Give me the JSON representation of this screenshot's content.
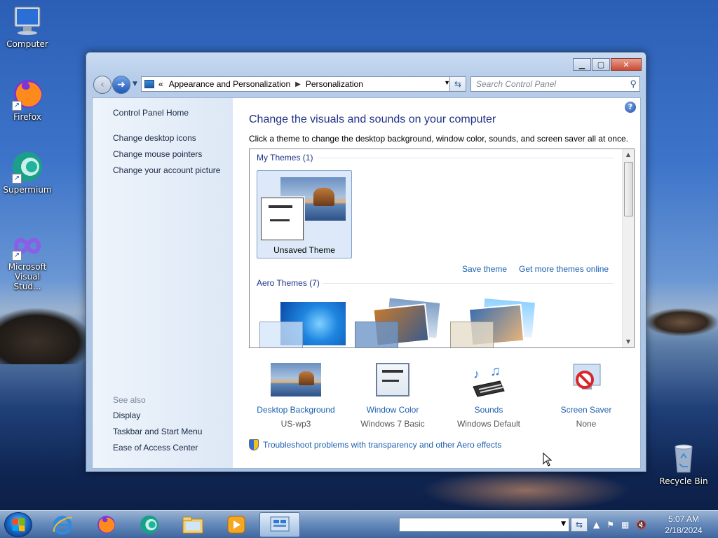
{
  "desktop": {
    "icons": [
      {
        "label": "Computer",
        "icon": "computer-icon"
      },
      {
        "label": "Firefox",
        "icon": "firefox-icon"
      },
      {
        "label": "Supermium",
        "icon": "supermium-icon"
      },
      {
        "label": "Microsoft Visual Stud...",
        "icon": "visual-studio-icon"
      },
      {
        "label": "Recycle Bin",
        "icon": "recycle-bin-icon"
      }
    ]
  },
  "window": {
    "address": {
      "prefix": "«",
      "crumbs": [
        "Appearance and Personalization",
        "Personalization"
      ]
    },
    "search_placeholder": "Search Control Panel",
    "left_pane": {
      "home": "Control Panel Home",
      "tasks": [
        "Change desktop icons",
        "Change mouse pointers",
        "Change your account picture"
      ],
      "see_also_label": "See also",
      "see_also": [
        "Display",
        "Taskbar and Start Menu",
        "Ease of Access Center"
      ]
    },
    "main": {
      "title": "Change the visuals and sounds on your computer",
      "description": "Click a theme to change the desktop background, window color, sounds, and screen saver all at once.",
      "my_themes_label": "My Themes (1)",
      "unsaved_theme": "Unsaved Theme",
      "save_theme": "Save theme",
      "get_more": "Get more themes online",
      "aero_themes_label": "Aero Themes (7)"
    },
    "bottom": [
      {
        "title": "Desktop Background",
        "sub": "US-wp3",
        "icon": "desktop-background-icon"
      },
      {
        "title": "Window Color",
        "sub": "Windows 7 Basic",
        "icon": "window-color-icon"
      },
      {
        "title": "Sounds",
        "sub": "Windows Default",
        "icon": "sounds-icon"
      },
      {
        "title": "Screen Saver",
        "sub": "None",
        "icon": "screen-saver-icon"
      }
    ],
    "troubleshoot": "Troubleshoot problems with transparency and other Aero effects"
  },
  "taskbar": {
    "time": "5:07 AM",
    "date": "2/18/2024"
  },
  "colors": {
    "link": "#1c5fb0",
    "title": "#1e3287"
  }
}
